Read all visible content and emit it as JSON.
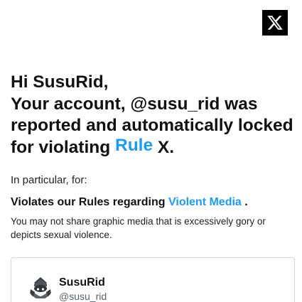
{
  "brand": {
    "logo_icon": "x-logo-icon",
    "logo_bg": "#000000"
  },
  "headline": {
    "line1": "Hi SusuRid,",
    "line2": "Your account, @susu_rid was reported and automatically locked for violating ",
    "rule_link": "Rule",
    "rule_suffix": " X."
  },
  "intro": "In particular, for:",
  "violation": {
    "prefix": "Violates our Rules regarding ",
    "policy_link": "Violent Media",
    "suffix": " .",
    "description": "You may not share graphic media that is excessively gory or depicts sexual violence."
  },
  "account_card": {
    "avatar_icon": "avatar-icon",
    "display_name": "SusuRid",
    "handle": "@susu_rid"
  },
  "colors": {
    "link": "#1d9bf0",
    "text": "#0f1419",
    "secondary": "#536471",
    "border": "#cfd9de"
  }
}
